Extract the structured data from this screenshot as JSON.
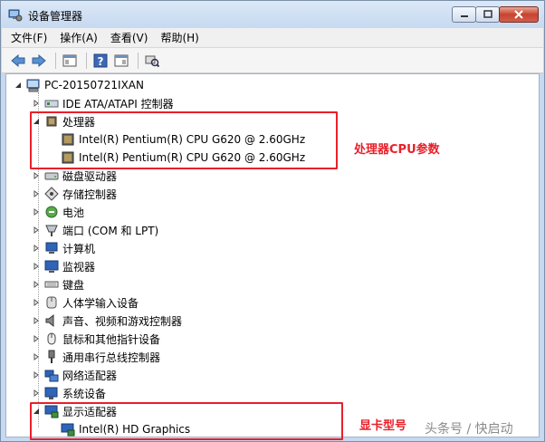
{
  "window": {
    "title": "设备管理器"
  },
  "menu": [
    "文件(F)",
    "操作(A)",
    "查看(V)",
    "帮助(H)"
  ],
  "toolbar_icons": [
    "back-arrow-icon",
    "forward-arrow-icon",
    "properties-icon",
    "help-icon",
    "view-icon",
    "scan-hardware-icon"
  ],
  "tree": {
    "root": "PC-20150721IXAN",
    "categories": [
      {
        "label": "IDE ATA/ATAPI 控制器",
        "icon": "ide-icon",
        "expanded": false
      },
      {
        "label": "处理器",
        "icon": "cpu-icon",
        "expanded": true,
        "children": [
          "Intel(R) Pentium(R) CPU G620 @ 2.60GHz",
          "Intel(R) Pentium(R) CPU G620 @ 2.60GHz"
        ]
      },
      {
        "label": "磁盘驱动器",
        "icon": "disk-icon",
        "expanded": false
      },
      {
        "label": "存储控制器",
        "icon": "storage-icon",
        "expanded": false
      },
      {
        "label": "电池",
        "icon": "battery-icon",
        "expanded": false
      },
      {
        "label": "端口 (COM 和 LPT)",
        "icon": "port-icon",
        "expanded": false
      },
      {
        "label": "计算机",
        "icon": "computer-icon",
        "expanded": false
      },
      {
        "label": "监视器",
        "icon": "monitor-icon",
        "expanded": false
      },
      {
        "label": "键盘",
        "icon": "keyboard-icon",
        "expanded": false
      },
      {
        "label": "人体学输入设备",
        "icon": "hid-icon",
        "expanded": false
      },
      {
        "label": "声音、视频和游戏控制器",
        "icon": "sound-icon",
        "expanded": false
      },
      {
        "label": "鼠标和其他指针设备",
        "icon": "mouse-icon",
        "expanded": false
      },
      {
        "label": "通用串行总线控制器",
        "icon": "usb-icon",
        "expanded": false
      },
      {
        "label": "网络适配器",
        "icon": "network-icon",
        "expanded": false
      },
      {
        "label": "系统设备",
        "icon": "system-icon",
        "expanded": false
      },
      {
        "label": "显示适配器",
        "icon": "display-icon",
        "expanded": true,
        "children": [
          "Intel(R) HD Graphics"
        ]
      }
    ]
  },
  "annotations": {
    "cpu_note": "处理器CPU参数",
    "gpu_note": "显卡型号"
  },
  "watermark": "头条号 / 快启动",
  "colors": {
    "annotation": "#e8202a",
    "titlebar": "#c6d9f0"
  }
}
